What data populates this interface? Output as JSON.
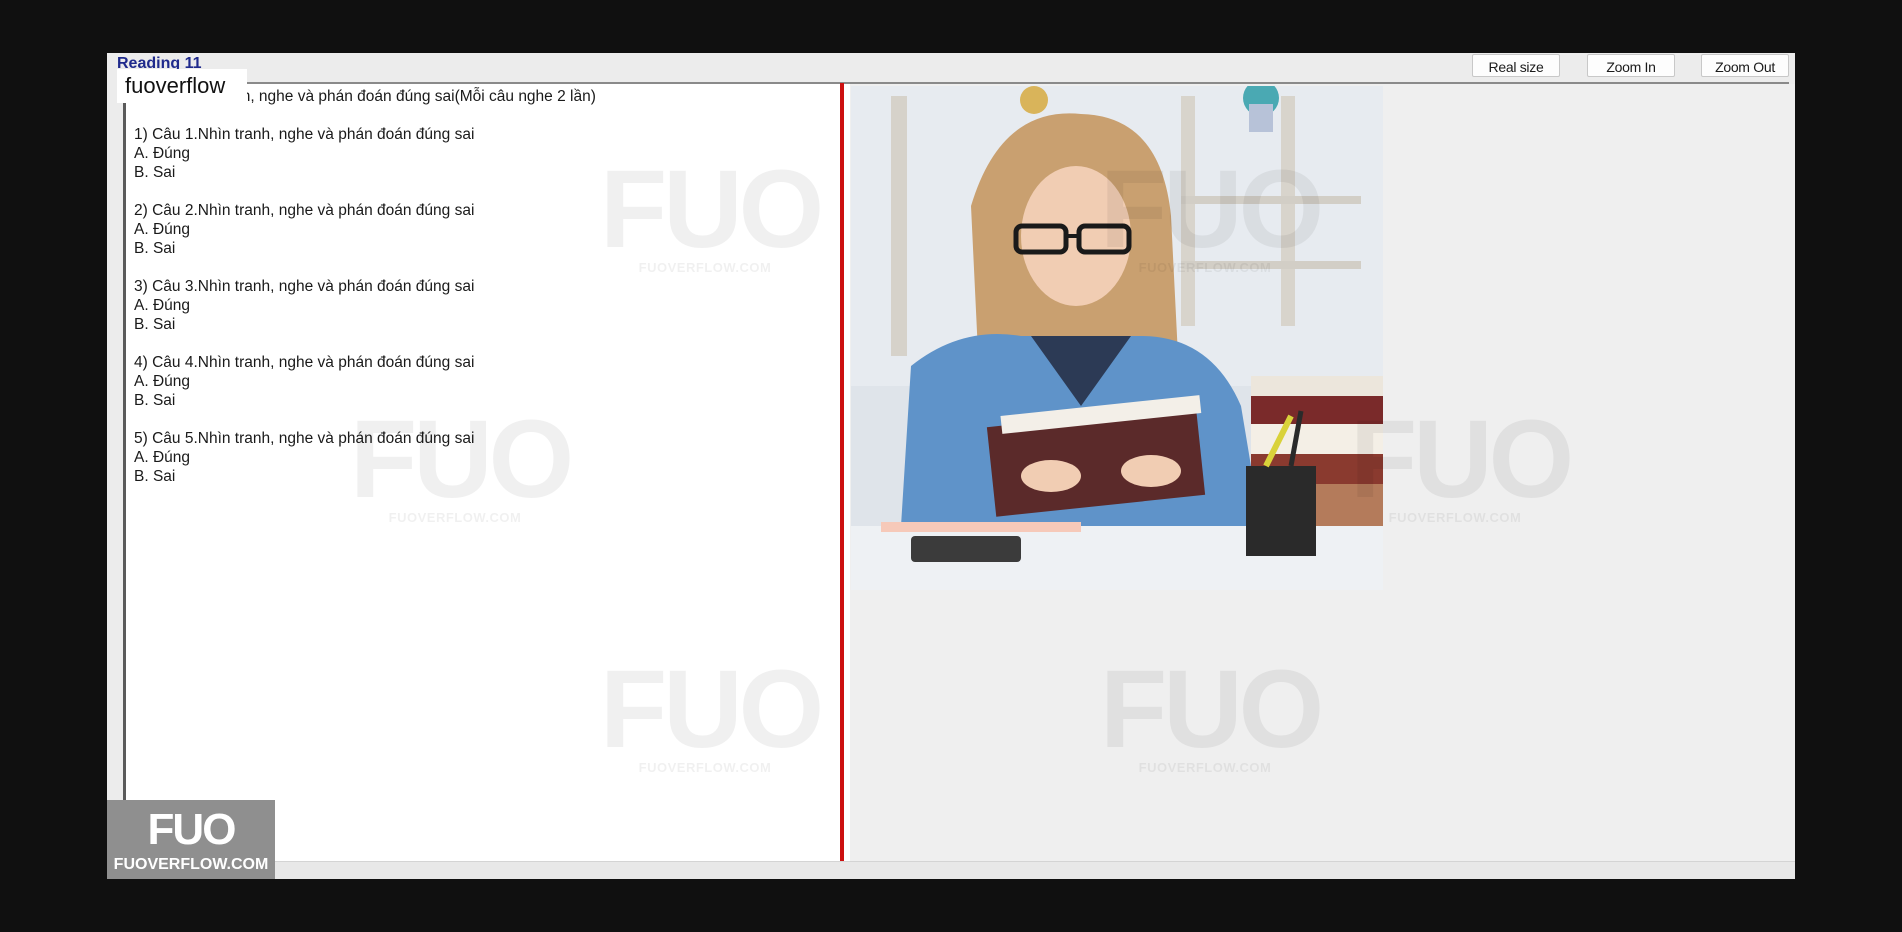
{
  "window": {
    "heading_partial": "Reading 11",
    "toolbar": {
      "real_size": "Real size",
      "zoom_in": "Zoom In",
      "zoom_out": "Zoom Out"
    }
  },
  "overlay": {
    "site_tag": "fuoverflow",
    "watermark_logo": "FUO",
    "watermark_text": "FUOVERFLOW.COM",
    "corner_logo": "FUO",
    "corner_text": "FUOVERFLOW.COM"
  },
  "content": {
    "section_title": "Bài 1. Nhìn tranh, nghe và phán đoán đúng sai(Mỗi câu nghe 2 lần)",
    "questions": [
      {
        "title": "1) Câu 1.Nhìn tranh, nghe và phán đoán đúng sai",
        "options": [
          "A.  Đúng",
          "B.  Sai"
        ]
      },
      {
        "title": "2) Câu 2.Nhìn tranh, nghe và phán đoán đúng sai",
        "options": [
          "A.  Đúng",
          "B.  Sai"
        ]
      },
      {
        "title": "3) Câu 3.Nhìn tranh, nghe và phán đoán đúng sai",
        "options": [
          "A.  Đúng",
          "B.  Sai"
        ]
      },
      {
        "title": "4) Câu 4.Nhìn tranh, nghe và phán đoán đúng sai",
        "options": [
          "A.  Đúng",
          "B.  Sai"
        ]
      },
      {
        "title": "5) Câu 5.Nhìn tranh, nghe và phán đoán đúng sai",
        "options": [
          "A.  Đúng",
          "B.  Sai"
        ]
      }
    ]
  },
  "colors": {
    "divider": "#cc1010",
    "heading": "#1f2a8c"
  },
  "image": {
    "icon": "photo-student-reading"
  }
}
